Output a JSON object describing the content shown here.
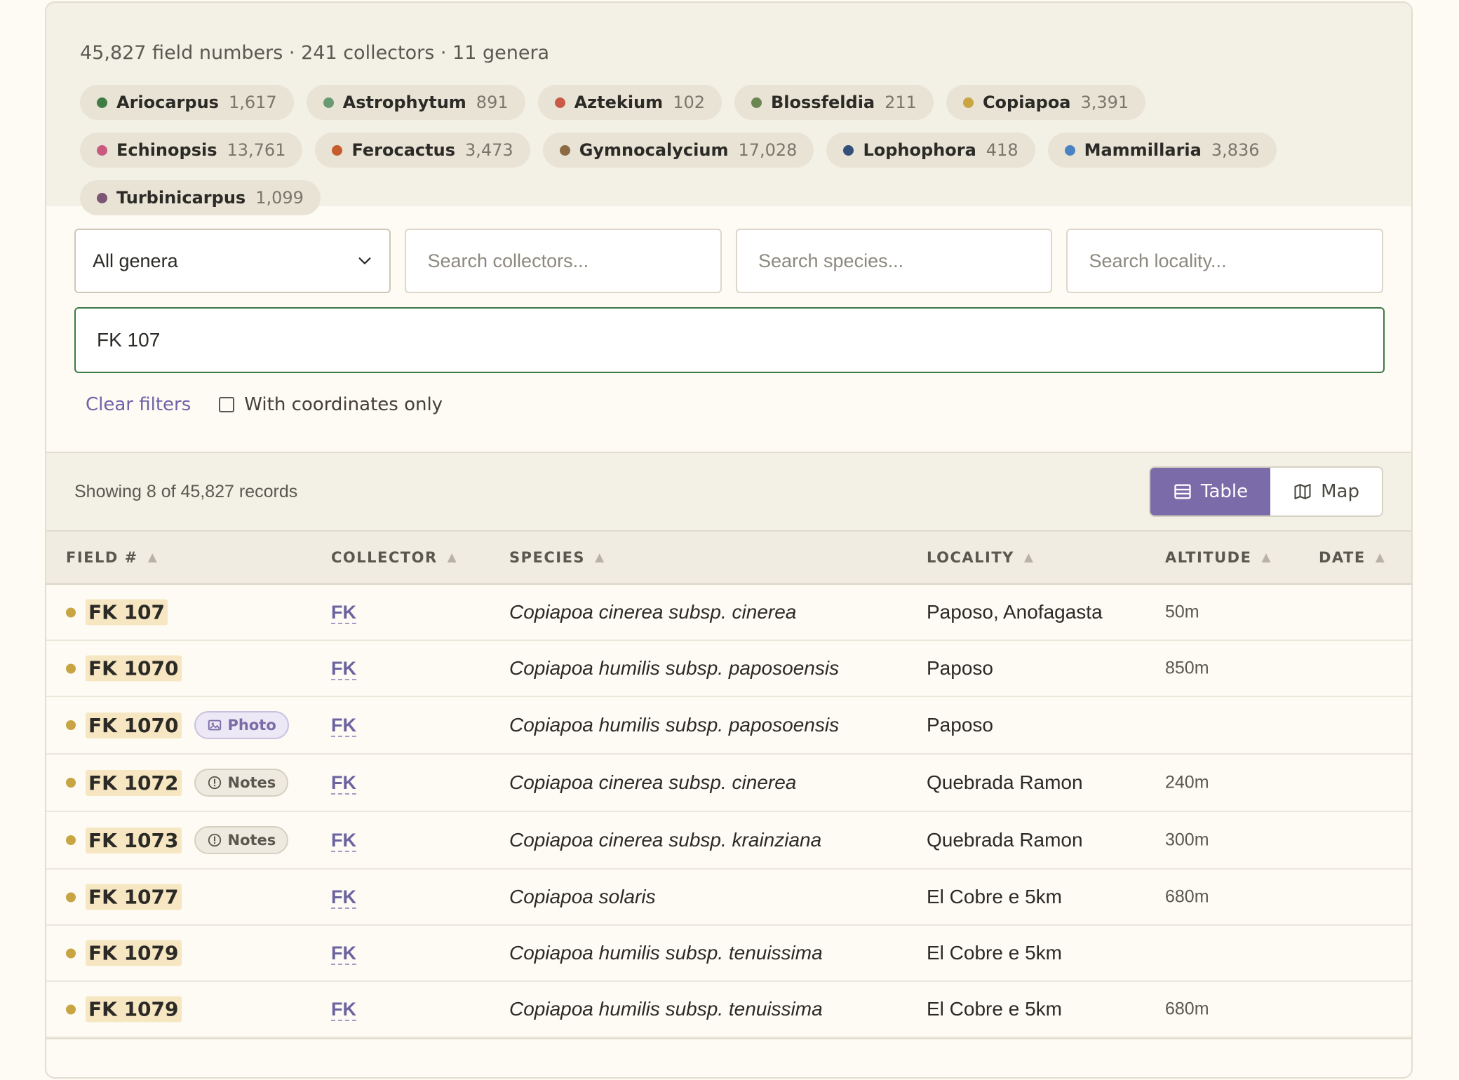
{
  "summary": {
    "text": "45,827 field numbers · 241 collectors · 11 genera",
    "genera": [
      {
        "name": "Ariocarpus",
        "count": "1,617",
        "color": "#3f7d45"
      },
      {
        "name": "Astrophytum",
        "count": "891",
        "color": "#6a9a73"
      },
      {
        "name": "Aztekium",
        "count": "102",
        "color": "#c95a45"
      },
      {
        "name": "Blossfeldia",
        "count": "211",
        "color": "#6b8650"
      },
      {
        "name": "Copiapoa",
        "count": "3,391",
        "color": "#c9a443"
      },
      {
        "name": "Echinopsis",
        "count": "13,761",
        "color": "#c85a7d"
      },
      {
        "name": "Ferocactus",
        "count": "3,473",
        "color": "#c65b2b"
      },
      {
        "name": "Gymnocalycium",
        "count": "17,028",
        "color": "#8b6a45"
      },
      {
        "name": "Lophophora",
        "count": "418",
        "color": "#33507a"
      },
      {
        "name": "Mammillaria",
        "count": "3,836",
        "color": "#4a83c3"
      },
      {
        "name": "Turbinicarpus",
        "count": "1,099",
        "color": "#7d5575"
      }
    ]
  },
  "filters": {
    "genus_select": "All genera",
    "collectors_placeholder": "Search collectors...",
    "species_placeholder": "Search species...",
    "locality_placeholder": "Search locality...",
    "field_search_value": "FK 107",
    "clear_label": "Clear filters",
    "coords_label": "With coordinates only"
  },
  "results": {
    "showing": "Showing 8 of 45,827 records",
    "view_table": "Table",
    "view_map": "Map"
  },
  "table": {
    "headers": [
      "FIELD #",
      "COLLECTOR",
      "SPECIES",
      "LOCALITY",
      "ALTITUDE",
      "DATE"
    ],
    "sort_glyph": "▲",
    "rows": [
      {
        "field": "FK 107",
        "badge": "",
        "collector": "FK",
        "species": "Copiapoa cinerea subsp. cinerea",
        "locality": "Paposo, Anofagasta",
        "altitude": "50m",
        "date": ""
      },
      {
        "field": "FK 1070",
        "badge": "",
        "collector": "FK",
        "species": "Copiapoa humilis subsp. paposoensis",
        "locality": "Paposo",
        "altitude": "850m",
        "date": ""
      },
      {
        "field": "FK 1070",
        "badge": "Photo",
        "collector": "FK",
        "species": "Copiapoa humilis subsp. paposoensis",
        "locality": "Paposo",
        "altitude": "",
        "date": ""
      },
      {
        "field": "FK 1072",
        "badge": "Notes",
        "collector": "FK",
        "species": "Copiapoa cinerea subsp. cinerea",
        "locality": "Quebrada Ramon",
        "altitude": "240m",
        "date": ""
      },
      {
        "field": "FK 1073",
        "badge": "Notes",
        "collector": "FK",
        "species": "Copiapoa cinerea subsp. krainziana",
        "locality": "Quebrada Ramon",
        "altitude": "300m",
        "date": ""
      },
      {
        "field": "FK 1077",
        "badge": "",
        "collector": "FK",
        "species": "Copiapoa solaris",
        "locality": "El Cobre e 5km",
        "altitude": "680m",
        "date": ""
      },
      {
        "field": "FK 1079",
        "badge": "",
        "collector": "FK",
        "species": "Copiapoa humilis subsp. tenuissima",
        "locality": "El Cobre e 5km",
        "altitude": "",
        "date": ""
      },
      {
        "field": "FK 1079",
        "badge": "",
        "collector": "FK",
        "species": "Copiapoa humilis subsp. tenuissima",
        "locality": "El Cobre e 5km",
        "altitude": "680m",
        "date": ""
      }
    ]
  }
}
